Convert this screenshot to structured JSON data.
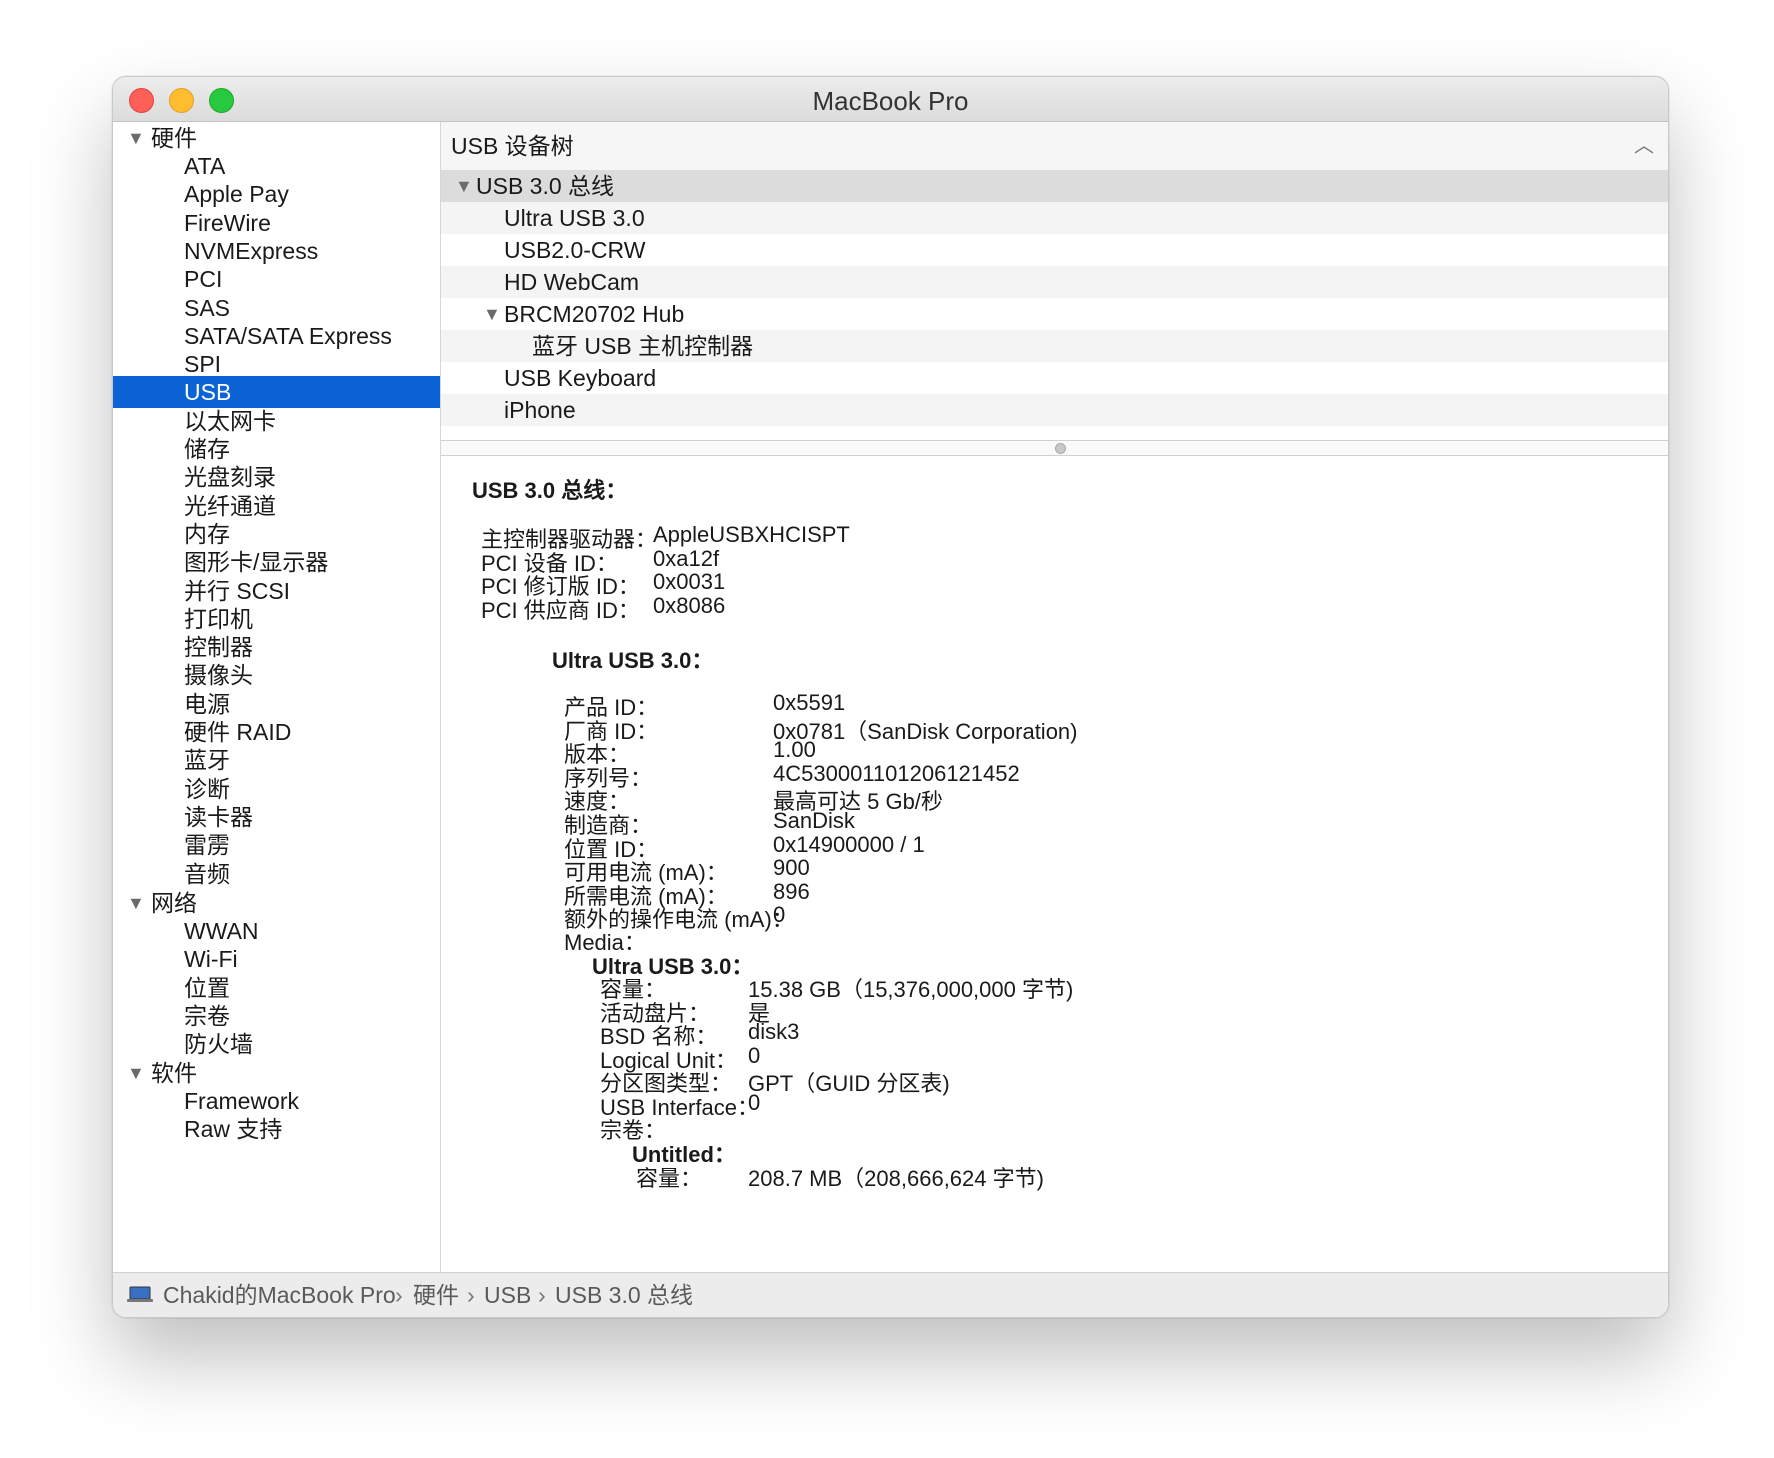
{
  "window": {
    "title": "MacBook Pro"
  },
  "sidebar": {
    "groups": {
      "hardware": "硬件",
      "network": "网络",
      "software": "软件"
    },
    "hardware_items": [
      "ATA",
      "Apple Pay",
      "FireWire",
      "NVMExpress",
      "PCI",
      "SAS",
      "SATA/SATA Express",
      "SPI",
      "USB",
      "以太网卡",
      "储存",
      "光盘刻录",
      "光纤通道",
      "内存",
      "图形卡/显示器",
      "并行 SCSI",
      "打印机",
      "控制器",
      "摄像头",
      "电源",
      "硬件 RAID",
      "蓝牙",
      "诊断",
      "读卡器",
      "雷雳",
      "音频"
    ],
    "network_items": [
      "WWAN",
      "Wi-Fi",
      "位置",
      "宗卷",
      "防火墙"
    ],
    "software_items": [
      "Framework",
      "Raw 支持"
    ],
    "selected": "USB"
  },
  "tree": {
    "header": "USB 设备树",
    "rows": [
      "USB 3.0 总线",
      "Ultra USB 3.0",
      "USB2.0-CRW",
      "HD WebCam",
      "BRCM20702 Hub",
      "蓝牙 USB 主机控制器",
      "USB Keyboard",
      "iPhone"
    ]
  },
  "detail": {
    "bus_title": "USB 3.0 总线：",
    "bus_props": [
      {
        "k": "主控制器驱动器：",
        "v": "AppleUSBXHCISPT"
      },
      {
        "k": "PCI 设备 ID：",
        "v": "0xa12f"
      },
      {
        "k": "PCI 修订版 ID：",
        "v": "0x0031"
      },
      {
        "k": "PCI 供应商 ID：",
        "v": "0x8086"
      }
    ],
    "device_title": "Ultra USB 3.0：",
    "device_props": [
      {
        "k": "产品 ID：",
        "v": "0x5591"
      },
      {
        "k": "厂商 ID：",
        "v": "0x0781（SanDisk Corporation)"
      },
      {
        "k": "版本：",
        "v": "1.00"
      },
      {
        "k": "序列号：",
        "v": "4C530001101206121452"
      },
      {
        "k": "速度：",
        "v": "最高可达 5 Gb/秒"
      },
      {
        "k": "制造商：",
        "v": "SanDisk"
      },
      {
        "k": "位置 ID：",
        "v": "0x14900000 / 1"
      },
      {
        "k": "可用电流 (mA)：",
        "v": "900"
      },
      {
        "k": "所需电流 (mA)：",
        "v": "896"
      },
      {
        "k": "额外的操作电流 (mA)：",
        "v": "0"
      }
    ],
    "media_label": "Media：",
    "media_title": "Ultra USB 3.0：",
    "media_props": [
      {
        "k": "容量：",
        "v": "15.38 GB（15,376,000,000 字节)"
      },
      {
        "k": "活动盘片：",
        "v": "是"
      },
      {
        "k": "BSD 名称：",
        "v": "disk3"
      },
      {
        "k": "Logical Unit：",
        "v": "0"
      },
      {
        "k": "分区图类型：",
        "v": "GPT（GUID 分区表)"
      },
      {
        "k": "USB Interface：",
        "v": "0"
      },
      {
        "k": "宗卷：",
        "v": ""
      }
    ],
    "volume_title": "Untitled：",
    "volume_props": [
      {
        "k": "容量：",
        "v": "208.7 MB（208,666,624 字节)"
      }
    ]
  },
  "statusbar": {
    "crumbs": [
      "Chakid的MacBook Pro",
      "硬件",
      "USB",
      "USB 3.0 总线"
    ],
    "separator": "›",
    "icon": "laptop-icon"
  },
  "colors": {
    "selection": "#0b63d6"
  }
}
